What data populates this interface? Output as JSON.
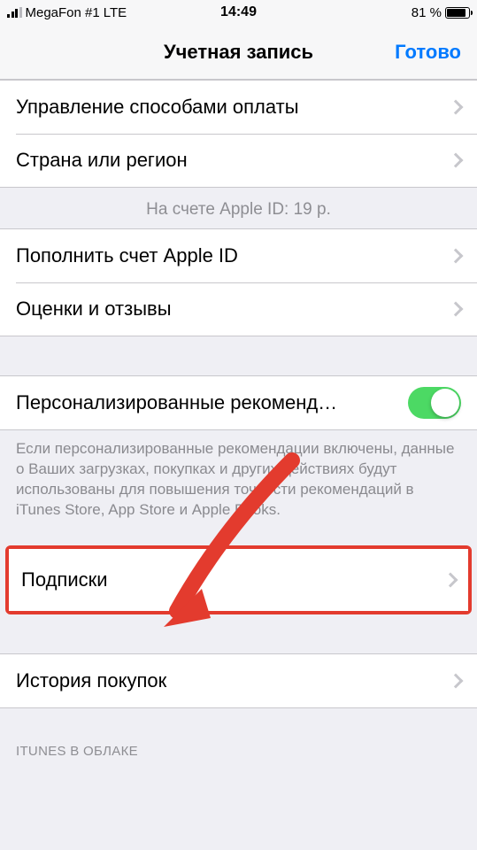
{
  "status": {
    "carrier": "MegaFon #1",
    "network": "LTE",
    "time": "14:49",
    "battery": "81 %"
  },
  "nav": {
    "title": "Учетная запись",
    "done": "Готово"
  },
  "rows": {
    "payment_methods": "Управление способами оплаты",
    "country": "Страна или регион",
    "balance_header": "На счете Apple ID: 19 р.",
    "add_funds": "Пополнить счет Apple ID",
    "ratings": "Оценки и отзывы",
    "personalized": "Персонализированные рекоменд…",
    "personalized_footer": "Если персонализированные рекомендации включены, данные о Ваших загрузках, покупках и других действиях будут использованы для повышения точности рекомендаций в iTunes Store, App Store и Apple Books.",
    "subscriptions": "Подписки",
    "purchase_history": "История покупок",
    "itunes_cloud": "iTUNES В ОБЛАКЕ"
  }
}
